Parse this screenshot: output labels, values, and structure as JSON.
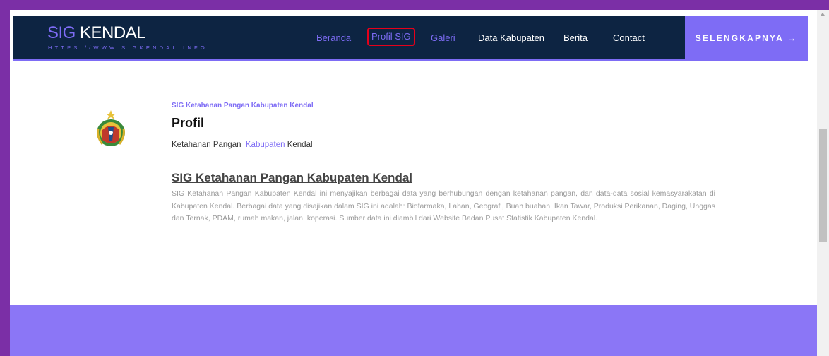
{
  "navbar": {
    "logo_main": "SIG",
    "logo_accent": "KENDAL",
    "logo_sub": "HTTPS://WWW.SIGKENDAL.INFO",
    "items": [
      {
        "label": "Beranda"
      },
      {
        "label": "Profil SIG"
      },
      {
        "label": "Galeri"
      },
      {
        "label": "Data Kabupaten"
      },
      {
        "label": "Berita"
      },
      {
        "label": "Contact"
      }
    ],
    "cta_label": "SELENGKAPNYA →"
  },
  "profile": {
    "eyebrow": "SIG Ketahanan Pangan Kabupaten Kendal",
    "heading": "Profil",
    "breadcrumb_start": "Ketahanan Pangan",
    "breadcrumb_link": "Kabupaten",
    "breadcrumb_end": "Kendal"
  },
  "section": {
    "title": "SIG Ketahanan Pangan Kabupaten Kendal",
    "body": "SIG Ketahanan Pangan Kabupaten Kendal ini menyajikan berbagai data yang berhubungan dengan ketahanan pangan, dan data-data sosial kemasyarakatan di Kabupaten Kendal. Berbagai data yang disajikan dalam SIG ini adalah: Biofarmaka, Lahan, Geografi, Buah buahan, Ikan Tawar, Produksi Perikanan, Daging, Unggas dan Ternak, PDAM, rumah makan, jalan, koperasi. Sumber data ini diambil dari Website Badan Pusat Statistik Kabupaten Kendal."
  },
  "colors": {
    "frame": "#7b2fa6",
    "nav_bg": "#0d2442",
    "accent": "#7e6cf5",
    "highlight": "#e5001a"
  },
  "icons": {
    "emblem": "kendal-regency-emblem-icon",
    "scroll_up": "scroll-up-arrow-icon"
  }
}
